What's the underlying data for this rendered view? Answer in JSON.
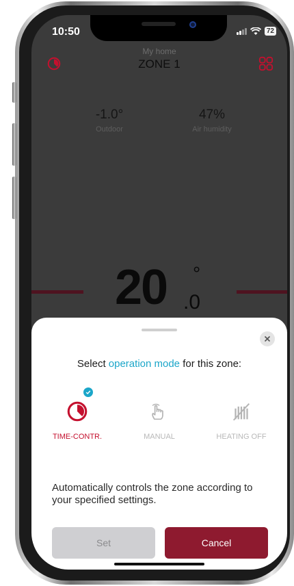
{
  "status_bar": {
    "time": "10:50",
    "battery": "72"
  },
  "header": {
    "subtitle": "My home",
    "title": "ZONE 1",
    "left_icon": "timer-icon",
    "right_icon": "grid-icon"
  },
  "metrics": [
    {
      "value": "-1.0°",
      "label": "Outdoor"
    },
    {
      "value": "47%",
      "label": "Air humidity"
    }
  ],
  "temperature": {
    "integer": "20",
    "decimal": ".0",
    "unit": "°"
  },
  "sheet": {
    "prompt_prefix": "Select ",
    "prompt_highlight": "operation mode",
    "prompt_suffix": " for this zone:",
    "modes": [
      {
        "label": "TIME-CONTR.",
        "icon": "timer-icon",
        "selected": true
      },
      {
        "label": "MANUAL",
        "icon": "hand-pointer-icon",
        "selected": false
      },
      {
        "label": "HEATING OFF",
        "icon": "heating-off-icon",
        "selected": false
      }
    ],
    "description": "Automatically controls the zone according to your specified settings.",
    "set_label": "Set",
    "cancel_label": "Cancel"
  },
  "colors": {
    "accent": "#C4102E",
    "highlight": "#1BA6C9",
    "cancel": "#8E1A2F",
    "set_disabled": "#CFCFD2"
  }
}
